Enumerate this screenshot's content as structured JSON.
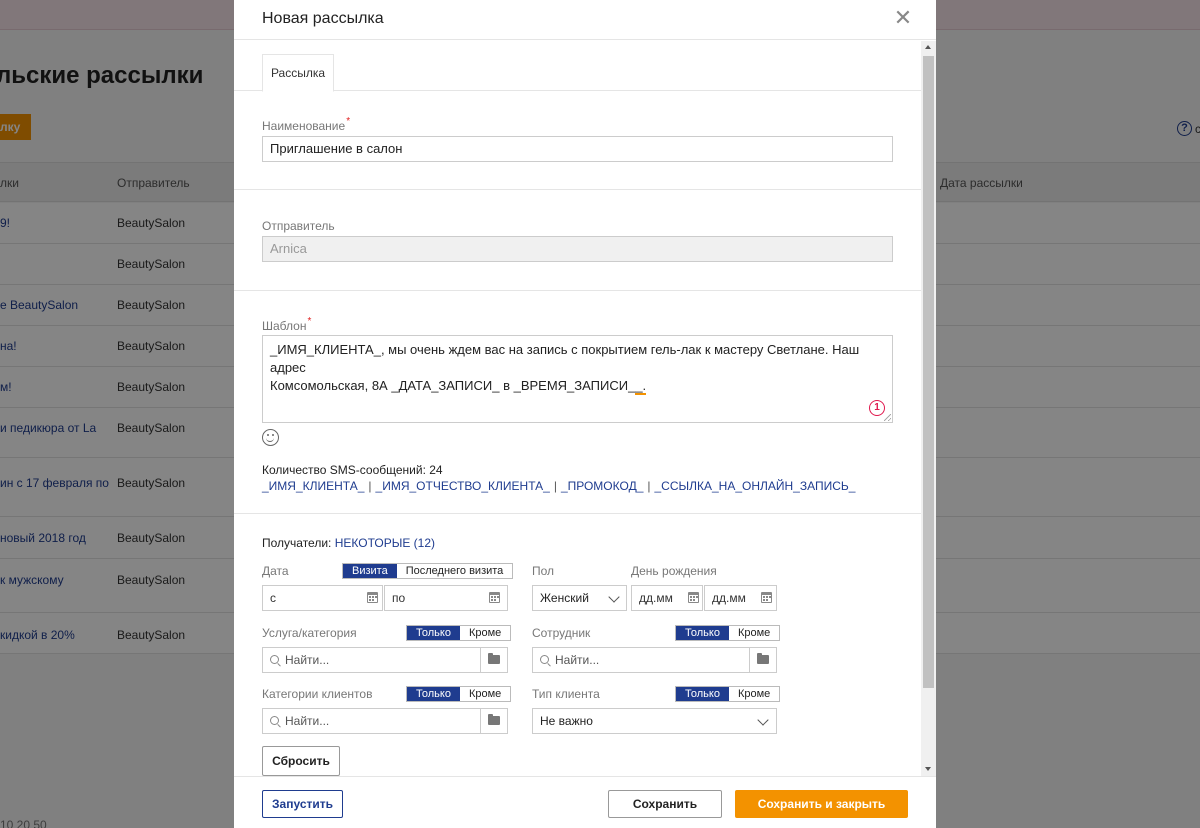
{
  "background": {
    "page_title": "льские рассылки",
    "create_button_label": "лку",
    "help_suffix": "с",
    "columns": {
      "name": "лки",
      "sender": "Отправитель",
      "date": "Дата рассылки"
    },
    "rows": [
      {
        "name": "9!",
        "sender": "BeautySalon"
      },
      {
        "name": "",
        "sender": "BeautySalon"
      },
      {
        "name": "e BeautySalon",
        "sender": "BeautySalon"
      },
      {
        "name": "на!",
        "sender": "BeautySalon"
      },
      {
        "name": "м!",
        "sender": "BeautySalon"
      },
      {
        "name": "и педикюра от La",
        "sender": "BeautySalon"
      },
      {
        "name": "ин с 17 февраля по",
        "sender": "BeautySalon"
      },
      {
        "name": "новый 2018 год",
        "sender": "BeautySalon"
      },
      {
        "name": "к мужскому",
        "sender": "BeautySalon"
      },
      {
        "name": "кидкой в 20%",
        "sender": "BeautySalon"
      }
    ],
    "pager": "10   20   50"
  },
  "modal": {
    "title": "Новая рассылка",
    "tab_label": "Рассылка",
    "name_label": "Наименование",
    "name_value": "Приглашение в салон",
    "sender_label": "Отправитель",
    "sender_value": "Arnica",
    "template_label": "Шаблон",
    "template_line1": "_ИМЯ_КЛИЕНТА_, мы очень ждем вас на запись с покрытием гель-лак к мастеру Светлане. Наш адрес",
    "template_line2": "Комсомольская, 8А _ДАТА_ЗАПИСИ_ в _ВРЕМЯ_ЗАПИСИ_",
    "template_line2_tail": "_.",
    "counter_badge": "1",
    "sms_count": "Количество SMS-сообщений: 24",
    "variables": [
      "_ИМЯ_КЛИЕНТА_",
      "_ИМЯ_ОТЧЕСТВО_КЛИЕНТА_",
      "_ПРОМОКОД_",
      "_ССЫЛКА_НА_ОНЛАЙН_ЗАПИСЬ_"
    ],
    "variable_separator": "|",
    "recipients_label": "Получатели:",
    "recipients_value": "НЕКОТОРЫЕ (12)",
    "date_label": "Дата",
    "date_toggle": [
      "Визита",
      "Последнего визита"
    ],
    "date_from_placeholder": "с",
    "date_to_placeholder": "по",
    "gender_label": "Пол",
    "gender_value": "Женский",
    "birthday_label": "День рождения",
    "birthday_from_placeholder": "дд.мм",
    "birthday_to_placeholder": "дд.мм",
    "service_label": "Услуга/категория",
    "only_label": "Только",
    "except_label": "Кроме",
    "search_placeholder": "Найти...",
    "employee_label": "Сотрудник",
    "client_categories_label": "Категории клиентов",
    "client_type_label": "Тип клиента",
    "client_type_value": "Не важно",
    "reset_label": "Сбросить"
  },
  "footer": {
    "launch_label": "Запустить",
    "save_label": "Сохранить",
    "save_close_label": "Сохранить и закрыть"
  },
  "colors": {
    "accent_blue": "#1f3c8f",
    "accent_orange": "#f39200",
    "required_red": "#e02020"
  }
}
